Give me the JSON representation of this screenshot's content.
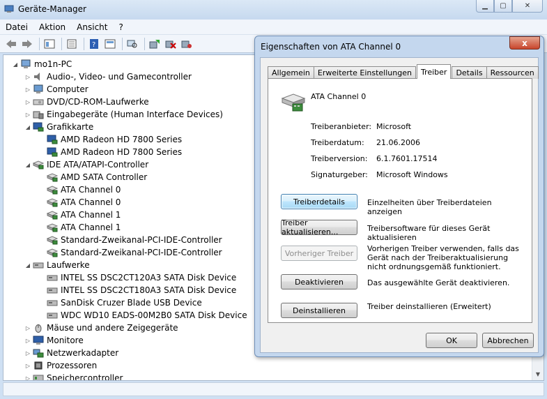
{
  "window": {
    "title": "Geräte-Manager"
  },
  "menu": [
    "Datei",
    "Aktion",
    "Ansicht",
    "?"
  ],
  "toolbar_icons": [
    "back-icon",
    "forward-icon",
    "tree-view-icon",
    "properties-icon",
    "help-icon",
    "list-view-icon",
    "scan-hardware-icon",
    "update-driver-icon",
    "disable-device-icon",
    "uninstall-device-icon"
  ],
  "tree": {
    "root": "mo1n-PC",
    "items": [
      {
        "label": "Audio-, Video- und Gamecontroller",
        "level": 1,
        "expander": "▷",
        "icon": "audio-icon"
      },
      {
        "label": "Computer",
        "level": 1,
        "expander": "▷",
        "icon": "computer-icon"
      },
      {
        "label": "DVD/CD-ROM-Laufwerke",
        "level": 1,
        "expander": "▷",
        "icon": "dvd-drive-icon"
      },
      {
        "label": "Eingabegeräte (Human Interface Devices)",
        "level": 1,
        "expander": "▷",
        "icon": "hid-icon"
      },
      {
        "label": "Grafikkarte",
        "level": 1,
        "expander": "◢",
        "icon": "display-adapter-icon"
      },
      {
        "label": "AMD Radeon HD 7800 Series",
        "level": 2,
        "expander": "",
        "icon": "display-adapter-icon"
      },
      {
        "label": "AMD Radeon HD 7800 Series",
        "level": 2,
        "expander": "",
        "icon": "display-adapter-icon"
      },
      {
        "label": "IDE ATA/ATAPI-Controller",
        "level": 1,
        "expander": "◢",
        "icon": "ide-controller-icon"
      },
      {
        "label": "AMD SATA Controller",
        "level": 2,
        "expander": "",
        "icon": "ide-controller-icon"
      },
      {
        "label": "ATA Channel 0",
        "level": 2,
        "expander": "",
        "icon": "ide-controller-icon"
      },
      {
        "label": "ATA Channel 0",
        "level": 2,
        "expander": "",
        "icon": "ide-controller-icon"
      },
      {
        "label": "ATA Channel 1",
        "level": 2,
        "expander": "",
        "icon": "ide-controller-icon"
      },
      {
        "label": "ATA Channel 1",
        "level": 2,
        "expander": "",
        "icon": "ide-controller-icon"
      },
      {
        "label": "Standard-Zweikanal-PCI-IDE-Controller",
        "level": 2,
        "expander": "",
        "icon": "ide-controller-icon"
      },
      {
        "label": "Standard-Zweikanal-PCI-IDE-Controller",
        "level": 2,
        "expander": "",
        "icon": "ide-controller-icon"
      },
      {
        "label": "Laufwerke",
        "level": 1,
        "expander": "◢",
        "icon": "disk-drive-icon"
      },
      {
        "label": "INTEL SS DSC2CT120A3 SATA Disk Device",
        "level": 2,
        "expander": "",
        "icon": "disk-drive-icon"
      },
      {
        "label": "INTEL SS DSC2CT180A3 SATA Disk Device",
        "level": 2,
        "expander": "",
        "icon": "disk-drive-icon"
      },
      {
        "label": "SanDisk Cruzer Blade USB Device",
        "level": 2,
        "expander": "",
        "icon": "disk-drive-icon"
      },
      {
        "label": "WDC WD10 EADS-00M2B0 SATA Disk Device",
        "level": 2,
        "expander": "",
        "icon": "disk-drive-icon"
      },
      {
        "label": "Mäuse und andere Zeigegeräte",
        "level": 1,
        "expander": "▷",
        "icon": "mouse-icon"
      },
      {
        "label": "Monitore",
        "level": 1,
        "expander": "▷",
        "icon": "monitor-icon"
      },
      {
        "label": "Netzwerkadapter",
        "level": 1,
        "expander": "▷",
        "icon": "network-adapter-icon"
      },
      {
        "label": "Prozessoren",
        "level": 1,
        "expander": "▷",
        "icon": "processor-icon"
      },
      {
        "label": "Speichercontroller",
        "level": 1,
        "expander": "▷",
        "icon": "storage-controller-icon"
      }
    ]
  },
  "dialog": {
    "title": "Eigenschaften von ATA Channel 0",
    "close": "x",
    "tabs": [
      "Allgemein",
      "Erweiterte Einstellungen",
      "Treiber",
      "Details",
      "Ressourcen"
    ],
    "active_tab": "Treiber",
    "device_name": "ATA Channel 0",
    "info": [
      {
        "label": "Treiberanbieter:",
        "value": "Microsoft"
      },
      {
        "label": "Treiberdatum:",
        "value": "21.06.2006"
      },
      {
        "label": "Treiberversion:",
        "value": "6.1.7601.17514"
      },
      {
        "label": "Signaturgeber:",
        "value": "Microsoft Windows"
      }
    ],
    "actions": [
      {
        "button": "Treiberdetails",
        "desc": "Einzelheiten über Treiberdateien anzeigen"
      },
      {
        "button": "Treiber aktualisieren...",
        "desc": "Treibersoftware für dieses Gerät aktualisieren"
      },
      {
        "button": "Vorheriger Treiber",
        "desc": "Vorherigen Treiber verwenden, falls das Gerät nach der Treiberaktualisierung nicht ordnungsgemäß funktioniert."
      },
      {
        "button": "Deaktivieren",
        "desc": "Das ausgewählte Gerät deaktivieren."
      },
      {
        "button": "Deinstallieren",
        "desc": "Treiber deinstallieren (Erweitert)"
      }
    ],
    "ok": "OK",
    "cancel": "Abbrechen"
  }
}
